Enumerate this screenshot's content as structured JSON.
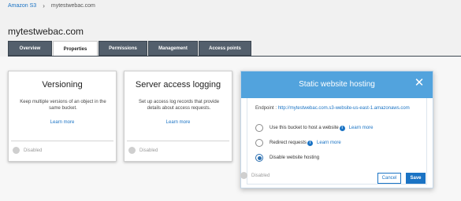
{
  "breadcrumb": {
    "root": "Amazon S3",
    "separator": "›",
    "current": "mytestwebac.com"
  },
  "page": {
    "title": "mytestwebac.com"
  },
  "tabs": [
    {
      "label": "Overview",
      "active": false
    },
    {
      "label": "Properties",
      "active": true
    },
    {
      "label": "Permissions",
      "active": false
    },
    {
      "label": "Management",
      "active": false
    },
    {
      "label": "Access points",
      "active": false
    }
  ],
  "cards": {
    "versioning": {
      "title": "Versioning",
      "description": "Keep multiple versions of an object in the same bucket.",
      "learn_more": "Learn more",
      "status": "Disabled"
    },
    "logging": {
      "title": "Server access logging",
      "description": "Set up access log records that provide details about access requests.",
      "learn_more": "Learn more",
      "status": "Disabled"
    }
  },
  "static_hosting": {
    "title": "Static website hosting",
    "close_icon": "close-icon",
    "endpoint_label": "Endpoint : ",
    "endpoint_url": "http://mytestwebac.com.s3-website-us-east-1.amazonaws.com",
    "options": [
      {
        "label": "Use this bucket to host a website",
        "info": "i",
        "link": "Learn more",
        "checked": false
      },
      {
        "label": "Redirect requests",
        "info": "i",
        "link": "Learn more",
        "checked": false
      },
      {
        "label": "Disable website hosting",
        "checked": true
      }
    ],
    "cancel_label": "Cancel",
    "save_label": "Save",
    "status": "Disabled"
  },
  "colors": {
    "accent": "#1a73c4",
    "tab_bg": "#535f6c",
    "modal_header": "#52a3dd"
  }
}
